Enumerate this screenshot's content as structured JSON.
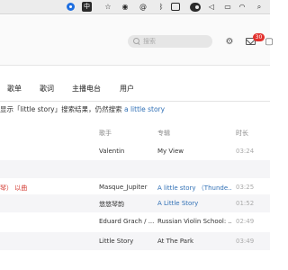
{
  "menubar": {
    "input_method_label": "中"
  },
  "search": {
    "placeholder": "搜索"
  },
  "header": {
    "mail_badge": "30"
  },
  "tabs": [
    {
      "label": "歌单"
    },
    {
      "label": "歌词"
    },
    {
      "label": "主播电台"
    },
    {
      "label": "用户"
    }
  ],
  "notice": {
    "prefix": "显示「little story」搜索结果，仍然搜索 ",
    "link": "a little story"
  },
  "table": {
    "headers": [
      "歌手",
      "专辑",
      "时长"
    ],
    "rows": [
      {
        "left": "",
        "artist": "Valentin",
        "album": "My View",
        "duration": "03:24",
        "album_link": false
      },
      {
        "left": "",
        "artist": "",
        "album": "",
        "duration": "",
        "album_link": false
      },
      {
        "left": "琴） 以曲",
        "artist": "Masque_Jupiter",
        "album": "A little story （Thunde...",
        "duration": "03:25",
        "album_link": true
      },
      {
        "left": "",
        "artist": "悠悠琴韵",
        "album": "A Little Story",
        "duration": "01:52",
        "album_link": true
      },
      {
        "left": "",
        "artist": "Eduard Grach / ...",
        "album": "Russian Violin School: ...",
        "duration": "02:49",
        "album_link": false
      },
      {
        "left": "",
        "artist": "Little Story",
        "album": "At The Park",
        "duration": "03:49",
        "album_link": false
      }
    ]
  }
}
